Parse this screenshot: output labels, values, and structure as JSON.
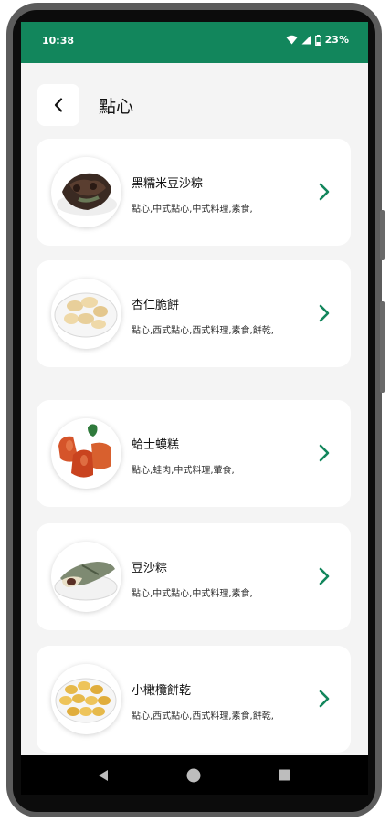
{
  "status_bar": {
    "time": "10:38",
    "battery": "23%",
    "background": "#12865c"
  },
  "header": {
    "title": "點心",
    "back_icon": "chevron-left-icon"
  },
  "items": [
    {
      "title": "黑糯米豆沙粽",
      "tags": "點心,中式點心,中式料理,素食,"
    },
    {
      "title": "杏仁脆餅",
      "tags": "點心,西式點心,西式料理,素食,餅乾,"
    },
    {
      "title": "蛤士蟆糕",
      "tags": "點心,蛙肉,中式料理,葷食,"
    },
    {
      "title": "豆沙粽",
      "tags": "點心,中式點心,中式料理,素食,"
    },
    {
      "title": "小橄欖餅乾",
      "tags": "點心,西式點心,西式料理,素食,餅乾,"
    }
  ],
  "nav": {
    "back": "back-triangle-icon",
    "home": "home-circle-icon",
    "recents": "recents-square-icon"
  },
  "colors": {
    "accent": "#12865c",
    "background": "#f4f4f4",
    "card": "#ffffff"
  }
}
